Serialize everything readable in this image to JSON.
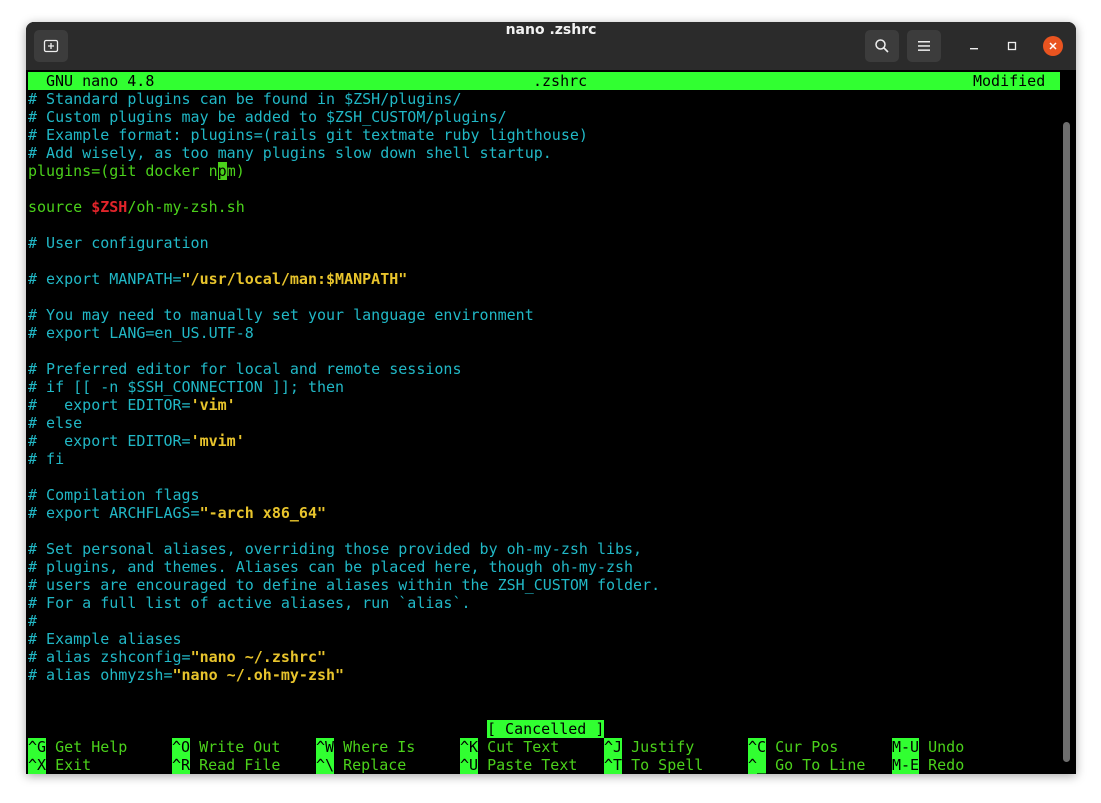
{
  "window": {
    "title": "nano .zshrc"
  },
  "nano": {
    "version": "GNU nano 4.8",
    "filename": ".zshrc",
    "state": "Modified",
    "status_message": "[ Cancelled ]"
  },
  "lines": [
    "# Standard plugins can be found in $ZSH/plugins/",
    "# Custom plugins may be added to $ZSH_CUSTOM/plugins/",
    "# Example format: plugins=(rails git textmate ruby lighthouse)",
    "# Add wisely, as too many plugins slow down shell startup.",
    [
      "plugins=(git docker n",
      "p",
      "m)"
    ],
    "",
    [
      "source ",
      "$ZSH",
      "/oh-my-zsh.sh"
    ],
    "",
    "# User configuration",
    "",
    [
      "# export MANPATH=",
      "\"/usr/local/man:$MANPATH\""
    ],
    "",
    "# You may need to manually set your language environment",
    "# export LANG=en_US.UTF-8",
    "",
    "# Preferred editor for local and remote sessions",
    "# if [[ -n $SSH_CONNECTION ]]; then",
    [
      "#   export EDITOR=",
      "'vim'"
    ],
    "# else",
    [
      "#   export EDITOR=",
      "'mvim'"
    ],
    "# fi",
    "",
    "# Compilation flags",
    [
      "# export ARCHFLAGS=",
      "\"-arch x86_64\""
    ],
    "",
    "# Set personal aliases, overriding those provided by oh-my-zsh libs,",
    "# plugins, and themes. Aliases can be placed here, though oh-my-zsh",
    "# users are encouraged to define aliases within the ZSH_CUSTOM folder.",
    "# For a full list of active aliases, run `alias`.",
    "#",
    "# Example aliases",
    [
      "# alias zshconfig=",
      "\"nano ~/.zshrc\""
    ],
    [
      "# alias ohmyzsh=",
      "\"nano ~/.oh-my-zsh\""
    ]
  ],
  "shortcuts_row1": [
    {
      "key": "^G",
      "label": "Get Help"
    },
    {
      "key": "^O",
      "label": "Write Out"
    },
    {
      "key": "^W",
      "label": "Where Is"
    },
    {
      "key": "^K",
      "label": "Cut Text"
    },
    {
      "key": "^J",
      "label": "Justify"
    },
    {
      "key": "^C",
      "label": "Cur Pos"
    },
    {
      "key": "M-U",
      "label": "Undo"
    }
  ],
  "shortcuts_row2": [
    {
      "key": "^X",
      "label": "Exit"
    },
    {
      "key": "^R",
      "label": "Read File"
    },
    {
      "key": "^\\",
      "label": "Replace"
    },
    {
      "key": "^U",
      "label": "Paste Text"
    },
    {
      "key": "^T",
      "label": "To Spell"
    },
    {
      "key": "^_",
      "label": "Go To Line"
    },
    {
      "key": "M-E",
      "label": "Redo"
    }
  ],
  "colors": {
    "comment": "#21b8c6",
    "code": "#4bd11b",
    "string": "#e8c42c",
    "variable": "#e0242a",
    "header_bg": "#31ff31"
  },
  "icons": [
    "new-tab-icon",
    "search-icon",
    "hamburger-menu-icon",
    "minimize-icon",
    "maximize-icon",
    "close-icon"
  ]
}
